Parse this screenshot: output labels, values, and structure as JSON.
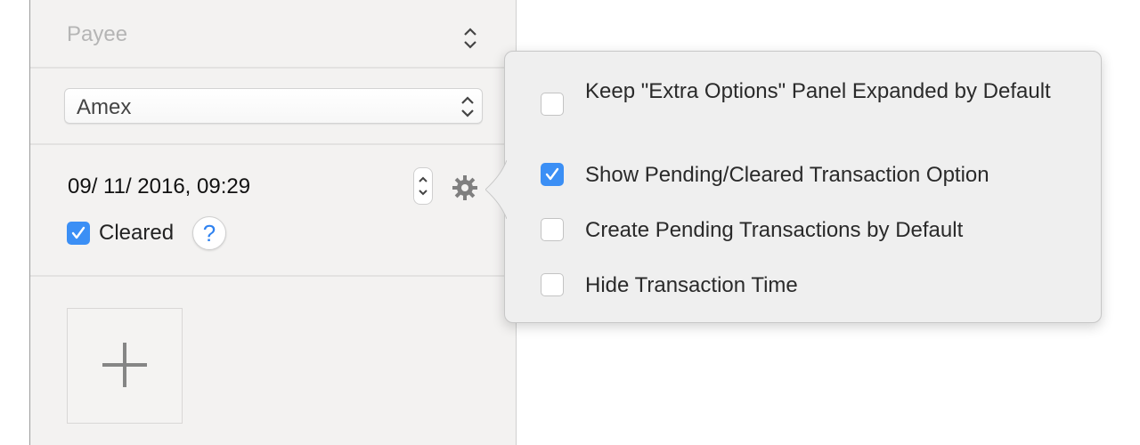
{
  "transaction_form": {
    "payee": {
      "placeholder": "Payee"
    },
    "account": {
      "selected": "Amex"
    },
    "date_time": {
      "value": "09/ 11/ 2016, 09:29"
    },
    "cleared": {
      "label": "Cleared",
      "checked": true
    },
    "help_button": {
      "label": "?"
    },
    "add_attachment": {
      "icon": "plus-icon"
    }
  },
  "options_popover": {
    "items": [
      {
        "label": "Keep \"Extra Options\" Panel Expanded by Default",
        "checked": false
      },
      {
        "label": "Show Pending/Cleared Transaction Option",
        "checked": true
      },
      {
        "label": "Create Pending Transactions by Default",
        "checked": false
      },
      {
        "label": "Hide Transaction Time",
        "checked": false
      }
    ]
  },
  "colors": {
    "accent": "#3b8ff5",
    "help_text": "#2f82f0",
    "panel_bg": "#f3f2f1",
    "popover_bg": "#efefef"
  }
}
